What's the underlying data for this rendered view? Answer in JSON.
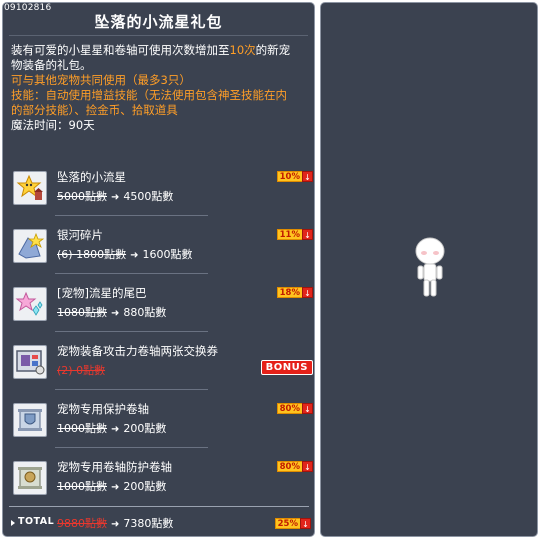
{
  "header": {
    "item_id": "09102816",
    "title": "坠落的小流星礼包"
  },
  "description": {
    "line1_pre": "装有可爱的小星星和卷轴可使用次数增加至",
    "line1_hl": "10次",
    "line1_post": "的新宠",
    "line2": "物装备的礼包。",
    "line3": "可与其他宠物共同使用（最多3只）",
    "line4": "技能：自动使用增益技能（无法使用包含神圣技能在内",
    "line5": "的部分技能）、捡金币、拾取道具",
    "line6": "魔法时间：90天"
  },
  "items": [
    {
      "name": "坠落的小流星",
      "old_price": "5000點數",
      "new_price": "4500點數",
      "discount": "10%",
      "icon": "star-pet-icon"
    },
    {
      "name": "银河碎片",
      "old_price": "(6) 1800點數",
      "new_price": "1600點數",
      "discount": "11%",
      "icon": "galaxy-shard-icon"
    },
    {
      "name": "[宠物]流星的尾巴",
      "old_price": "1080點數",
      "new_price": "880點數",
      "discount": "18%",
      "icon": "star-tail-icon"
    },
    {
      "name": "宠物装备攻击力卷轴两张交换券",
      "old_price": "(2) 0點數",
      "new_price": "",
      "discount": "",
      "bonus": "BONUS",
      "icon": "exchange-voucher-icon"
    },
    {
      "name": "宠物专用保护卷轴",
      "old_price": "1000點數",
      "new_price": "200點數",
      "discount": "80%",
      "icon": "protect-scroll-icon"
    },
    {
      "name": "宠物专用卷轴防护卷轴",
      "old_price": "1000點數",
      "new_price": "200點數",
      "discount": "80%",
      "icon": "shield-scroll-icon"
    }
  ],
  "total": {
    "label": "TOTAL",
    "old_price": "9880點數",
    "new_price": "7380點數",
    "discount": "25%"
  },
  "colors": {
    "panel_bg": "#3b4250",
    "highlight": "#ff9e27",
    "discount_bg": "#ffc31f",
    "bonus_bg": "#e52119"
  }
}
